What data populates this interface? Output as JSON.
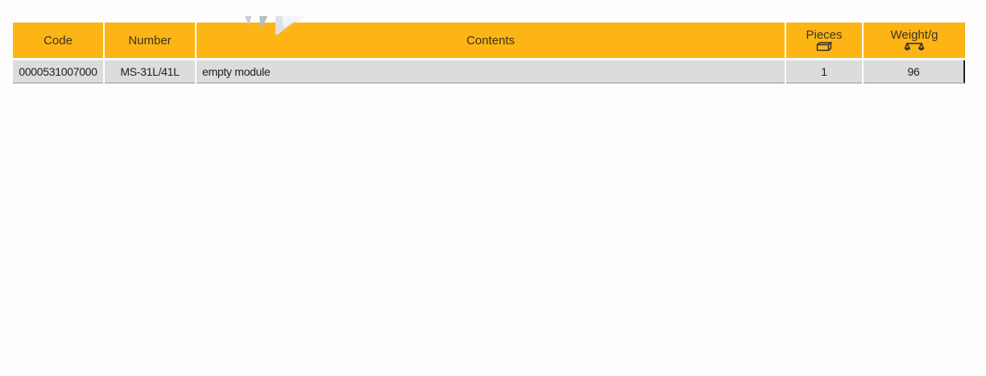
{
  "table": {
    "headers": {
      "code": "Code",
      "number": "Number",
      "contents": "Contents",
      "pieces": "Pieces",
      "weight": "Weight/g"
    },
    "header_icons": {
      "pieces": "pieces-box-icon",
      "weight": "scale-icon"
    },
    "rows": [
      {
        "code": "0000531007000",
        "number": "MS-31L/41L",
        "contents": "empty module",
        "pieces": "1",
        "weight": "96"
      }
    ]
  },
  "colors": {
    "header_background": "#fdb515",
    "row_background": "#dcdcdc"
  }
}
